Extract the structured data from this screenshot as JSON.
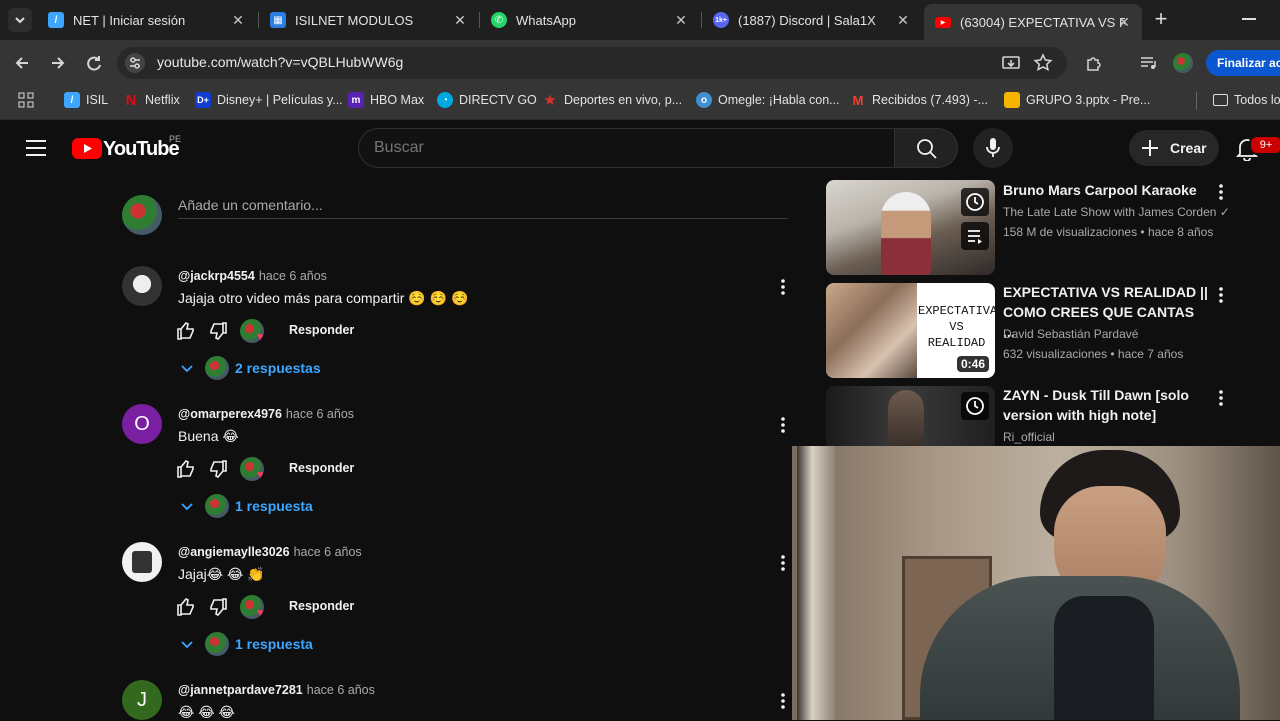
{
  "browser": {
    "tabs": [
      {
        "title": "NET | Iniciar sesión",
        "icon": "net-icon",
        "color": "#3ea6ff"
      },
      {
        "title": "ISILNET MODULOS",
        "icon": "isil-icon",
        "color": "#2a7de1"
      },
      {
        "title": "WhatsApp",
        "icon": "whatsapp-icon",
        "color": "#25d366"
      },
      {
        "title": "(1887) Discord | Sala1X",
        "icon": "discord-icon",
        "color": "#5865f2"
      },
      {
        "title": "(63004) EXPECTATIVA VS RE",
        "icon": "youtube-icon",
        "color": "#ff0000"
      }
    ],
    "url": "youtube.com/watch?v=vQBLHubWW6g",
    "finalizar_label": "Finalizar act",
    "bookmarks": [
      {
        "label": "ISIL",
        "color": "#3ea6ff"
      },
      {
        "label": "Netflix",
        "color": "#e50914"
      },
      {
        "label": "Disney+ | Películas y...",
        "color": "#113ccf"
      },
      {
        "label": "HBO Max",
        "color": "#5822b4"
      },
      {
        "label": "DIRECTV GO",
        "color": "#00a8e1"
      },
      {
        "label": "Deportes en vivo, p...",
        "color": "#d9302b"
      },
      {
        "label": "Omegle: ¡Habla con...",
        "color": "#3f8fd2"
      },
      {
        "label": "Recibidos (7.493) -...",
        "color": "#ea4335"
      },
      {
        "label": "GRUPO 3.pptx - Pre...",
        "color": "#f4b400"
      },
      {
        "label": "Todos lo",
        "color": "#8a8a8a"
      }
    ]
  },
  "youtube": {
    "logo_text": "YouTube",
    "country": "PE",
    "search_placeholder": "Buscar",
    "crear_label": "Crear",
    "notif_count": "9+"
  },
  "comments": {
    "add_placeholder": "Añade un comentario...",
    "reply_label": "Responder",
    "items": [
      {
        "user": "@jackrp4554",
        "time": "hace 6 años",
        "text": "Jajaja otro video más para compartir ☺️ ☺️ ☺️",
        "replies": "2 respuestas",
        "avatar": "",
        "avatar_color": "#555"
      },
      {
        "user": "@omarperex4976",
        "time": "hace 6 años",
        "text": "Buena 😂",
        "replies": "1 respuesta",
        "avatar": "O",
        "avatar_color": "#7b1fa2"
      },
      {
        "user": "@angiemaylle3026",
        "time": "hace 6 años",
        "text": "Jajaj😂 😂 👏",
        "replies": "1 respuesta",
        "avatar": "",
        "avatar_color": "#f1f1f1"
      },
      {
        "user": "@jannetpardave7281",
        "time": "hace 6 años",
        "text": "😂 😂 😂",
        "replies": "",
        "avatar": "J",
        "avatar_color": "#33691e"
      }
    ]
  },
  "suggestions": [
    {
      "title": "Bruno Mars Carpool Karaoke",
      "channel": "The Late Late Show with James Corden ✓",
      "meta": "158 M de visualizaciones • hace 8 años",
      "duration": ""
    },
    {
      "title": "EXPECTATIVA VS REALIDAD || COMO CREES QUE CANTAS ...",
      "channel": "David Sebastián Pardavé",
      "meta": "632 visualizaciones • hace 7 años",
      "duration": "0:46",
      "thumb_text_1": "EXPECTATIVA",
      "thumb_text_2": "VS",
      "thumb_text_3": "REALIDAD"
    },
    {
      "title": "ZAYN - Dusk Till Dawn [solo version with high note]",
      "channel": "Ri_official",
      "meta": "",
      "duration": ""
    }
  ]
}
